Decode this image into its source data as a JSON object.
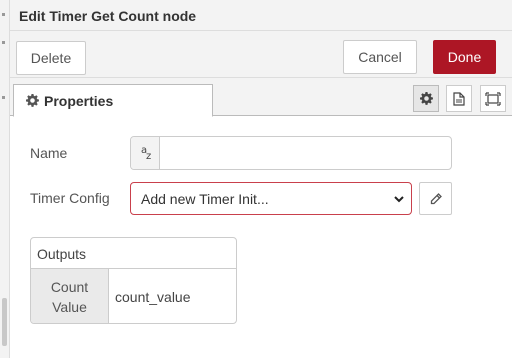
{
  "tray": {
    "title": "Edit Timer Get Count node"
  },
  "toolbar": {
    "delete_label": "Delete",
    "cancel_label": "Cancel",
    "done_label": "Done",
    "done_color": "#ad1625"
  },
  "tabs": {
    "properties_label": "Properties",
    "properties_icon": "gear-icon",
    "icon_tabs": [
      "settings-gear-icon",
      "description-document-icon",
      "appearance-frame-icon"
    ]
  },
  "form": {
    "name_label": "Name",
    "name_prefix": "az",
    "name_value": "",
    "timer_config_label": "Timer Config",
    "timer_config_selected": "Add new Timer Init...",
    "timer_config_invalid_color": "#c9404c",
    "edit_icon": "pencil-icon"
  },
  "outputs": {
    "header": "Outputs",
    "rows": [
      {
        "key_line1": "Count",
        "key_line2": "Value",
        "value": "count_value"
      }
    ]
  }
}
